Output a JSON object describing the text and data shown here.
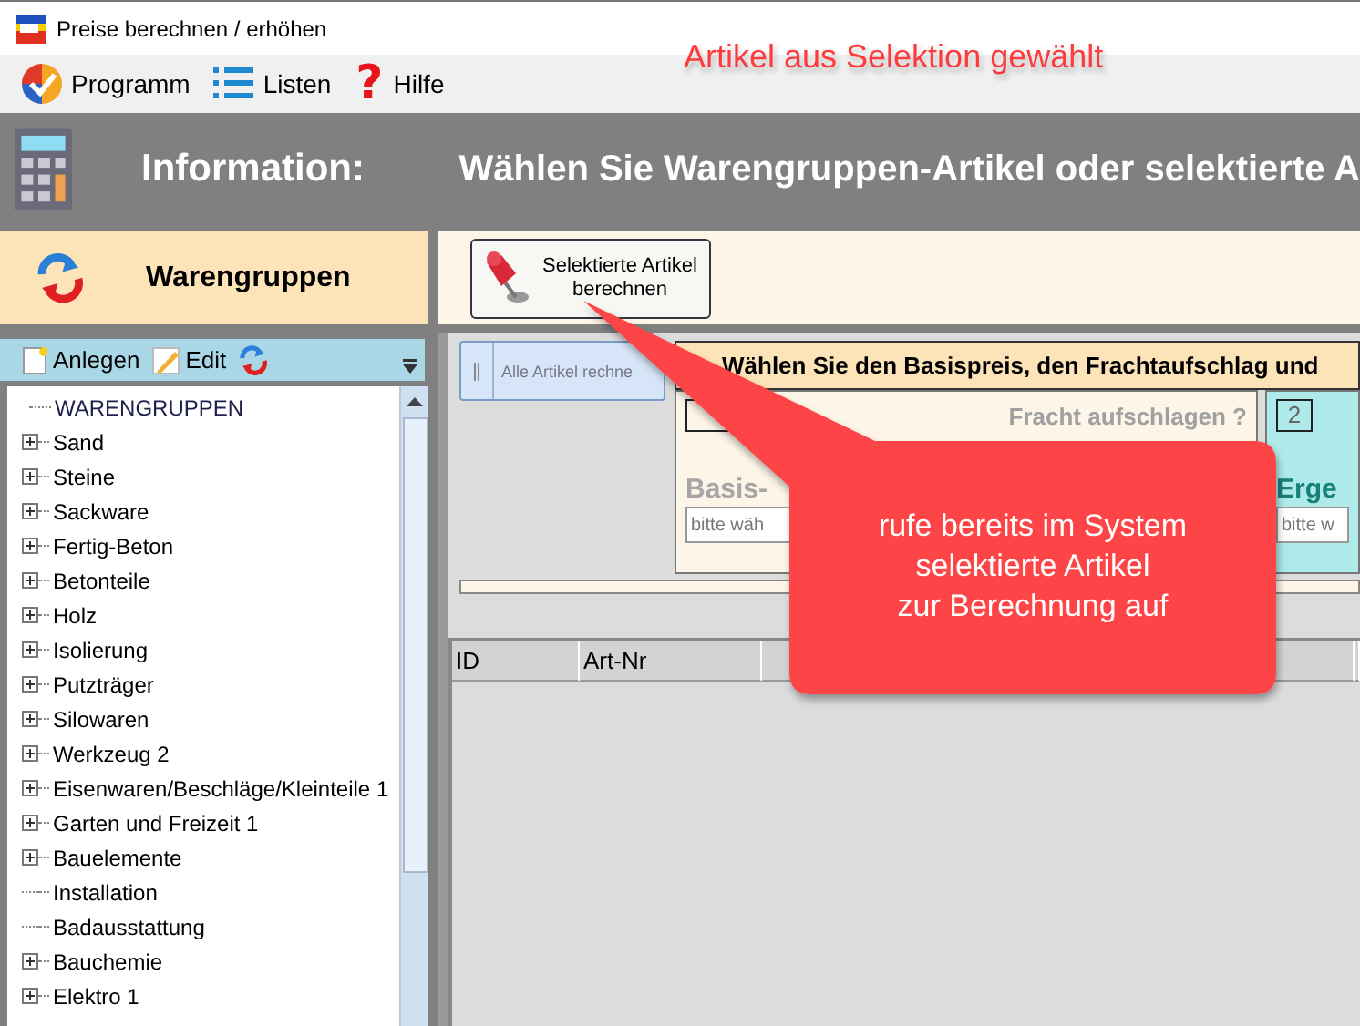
{
  "window": {
    "title": "Preise berechnen / erhöhen"
  },
  "menu": [
    {
      "label": "Programm",
      "kind": "check"
    },
    {
      "label": "Listen",
      "kind": "list"
    },
    {
      "label": "Hilfe",
      "kind": "help",
      "glyph": "?"
    }
  ],
  "annotation": {
    "title": "Artikel aus Selektion gewählt",
    "callout": "rufe bereits im System\nselektierte Artikel\nzur Berechnung auf"
  },
  "header": {
    "label": "Information:",
    "message": "Wählen Sie Warengruppen-Artikel oder selektierte A"
  },
  "sidebar": {
    "title": "Warengruppen",
    "toolbar": [
      {
        "label": "Anlegen",
        "kind": "new"
      },
      {
        "label": "Edit",
        "kind": "edit"
      },
      {
        "kind": "refresh"
      }
    ],
    "tree": {
      "label": "WARENGRUPPEN",
      "children": [
        {
          "label": "Sand",
          "expandable": true
        },
        {
          "label": "Steine",
          "expandable": true
        },
        {
          "label": "Sackware",
          "expandable": true
        },
        {
          "label": "Fertig-Beton",
          "expandable": true
        },
        {
          "label": "Betonteile",
          "expandable": true
        },
        {
          "label": "Holz",
          "expandable": true
        },
        {
          "label": "Isolierung",
          "expandable": true
        },
        {
          "label": "Putzträger",
          "expandable": true
        },
        {
          "label": "Silowaren",
          "expandable": true
        },
        {
          "label": "Werkzeug 2",
          "expandable": true
        },
        {
          "label": "Eisenwaren/Beschläge/Kleinteile 1",
          "expandable": true
        },
        {
          "label": "Garten und Freizeit 1",
          "expandable": true
        },
        {
          "label": "Bauelemente",
          "expandable": true
        },
        {
          "label": "Installation",
          "expandable": false
        },
        {
          "label": "Badausstattung",
          "expandable": false
        },
        {
          "label": "Bauchemie",
          "expandable": true
        },
        {
          "label": "Elektro 1",
          "expandable": true
        }
      ]
    }
  },
  "action_button": {
    "label": "Selektierte Artikel\nberechnen"
  },
  "toolstrip": {
    "label": "Alle Artikel rechne"
  },
  "step_panel": {
    "heading": "Wählen Sie den Basispreis, den Frachtaufschlag und",
    "steps": [
      {
        "kind": "base",
        "question": "Fracht aufschlagen ?",
        "label": "Basis-",
        "placeholder": "bitte wäh"
      },
      {
        "kind": "result",
        "number": "2",
        "label": "Erge",
        "placeholder": "bitte w"
      }
    ]
  },
  "table": {
    "columns": [
      "ID",
      "Art-Nr"
    ]
  }
}
